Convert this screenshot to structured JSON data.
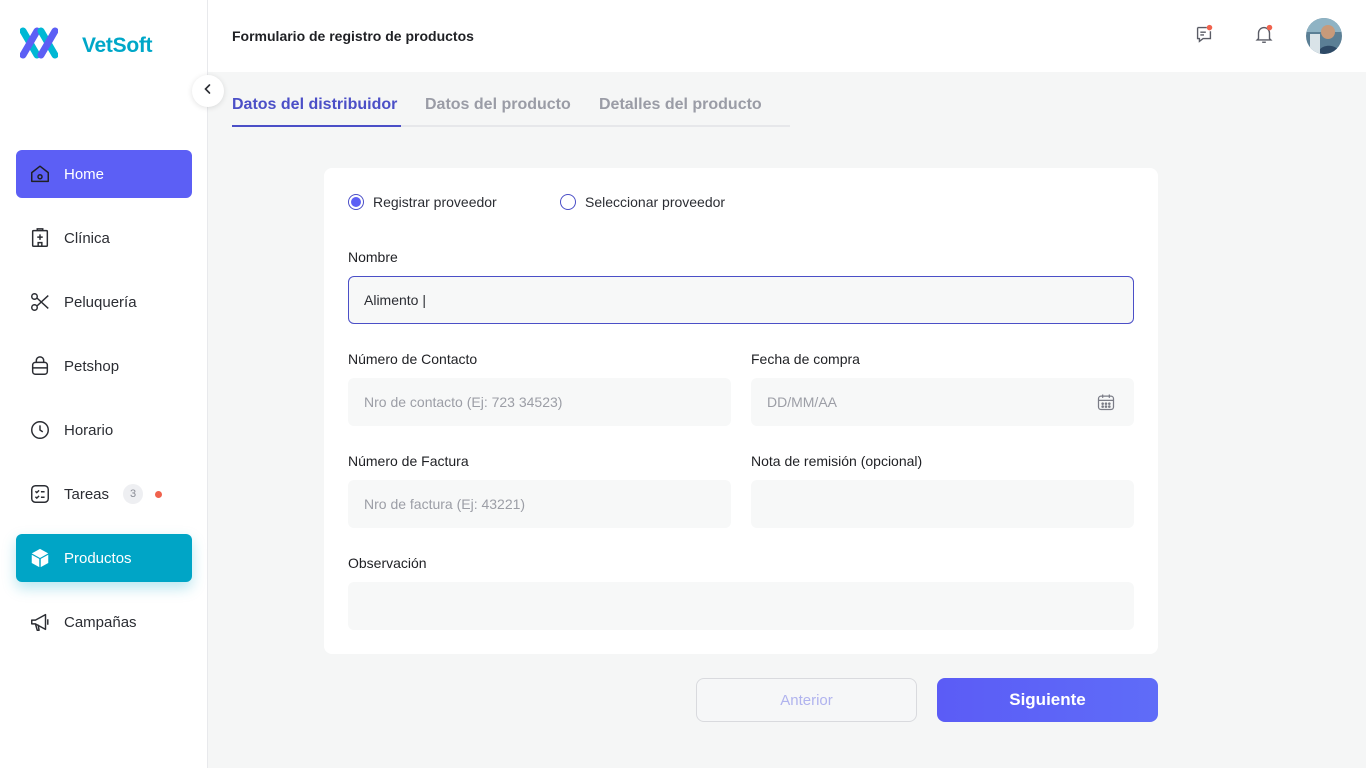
{
  "app": {
    "name": "VetSoft",
    "accent": "#5c5ff5",
    "brand": "#00a7c8"
  },
  "header": {
    "title": "Formulario de registro de productos",
    "icons": [
      "chat-notification-icon",
      "bell-icon"
    ]
  },
  "sidebar": {
    "items": [
      {
        "label": "Home",
        "icon": "home-icon"
      },
      {
        "label": "Clínica",
        "icon": "clinic-icon"
      },
      {
        "label": "Peluquería",
        "icon": "scissors-icon"
      },
      {
        "label": "Petshop",
        "icon": "bag-icon"
      },
      {
        "label": "Horario",
        "icon": "clock-icon"
      },
      {
        "label": "Tareas",
        "icon": "checklist-icon",
        "badge": "3"
      },
      {
        "label": "Productos",
        "icon": "cube-icon",
        "active": true
      },
      {
        "label": "Campañas",
        "icon": "megaphone-icon"
      }
    ]
  },
  "tabs": [
    {
      "label": "Datos del distribuidor",
      "active": true
    },
    {
      "label": "Datos del producto"
    },
    {
      "label": "Detalles del producto"
    }
  ],
  "form": {
    "radio_register": "Registrar proveedor",
    "radio_select": "Seleccionar proveedor",
    "nombre": {
      "label": "Nombre",
      "value": "Alimento |"
    },
    "contacto": {
      "label": "Número de Contacto",
      "placeholder": "Nro de contacto (Ej: 723 34523)"
    },
    "fecha": {
      "label": "Fecha de compra",
      "placeholder": "DD/MM/AA"
    },
    "factura": {
      "label": "Número de Factura",
      "placeholder": "Nro de factura (Ej: 43221)"
    },
    "remision": {
      "label": "Nota de remisión (opcional)",
      "placeholder": ""
    },
    "observacion": {
      "label": "Observación",
      "placeholder": ""
    }
  },
  "buttons": {
    "prev": "Anterior",
    "next": "Siguiente"
  }
}
